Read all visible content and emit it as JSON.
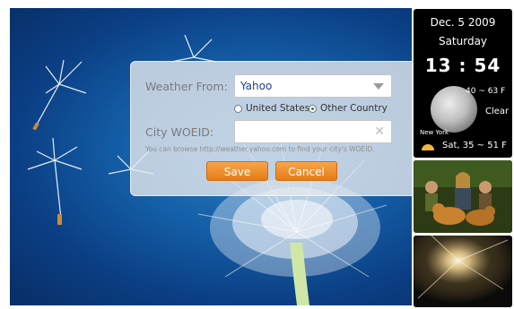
{
  "dialog": {
    "weather_from_label": "Weather From:",
    "provider_selected": "Yahoo",
    "radio_united_states": "United States",
    "radio_other_country": "Other Country",
    "radio_selected": "Other Country",
    "city_woeid_label": "City WOEID:",
    "city_woeid_value": "",
    "hint_text": "You can browse http://weather.yahoo.com to find your city's WOEID.",
    "save_label": "Save",
    "cancel_label": "Cancel"
  },
  "clock_widget": {
    "date": "Dec. 5 2009",
    "weekday": "Saturday",
    "time": "13 : 54",
    "temp_range": "40 ~ 63 F",
    "condition": "Clear",
    "city": "New York",
    "forecast": "Sat, 35 ~ 51 F",
    "icons": [
      "moon-icon",
      "sun-icon"
    ]
  },
  "photo_widgets": [
    "photo-frame-family-dogs",
    "photo-frame-sunburst"
  ],
  "colors": {
    "button_orange": "#f0932f",
    "selected_text": "#1f3f8f",
    "wallpaper_blue": "#145fa8"
  }
}
